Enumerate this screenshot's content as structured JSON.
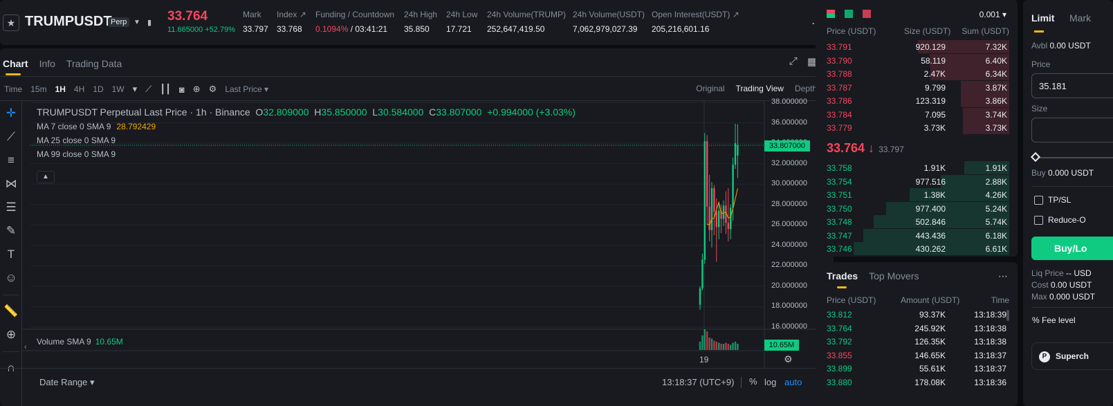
{
  "header": {
    "symbol": "TRUMPUSDT",
    "contract_type": "Perp",
    "last_price": "33.764",
    "change_abs": "11.665000",
    "change_pct": "+52.79%",
    "stats": [
      {
        "label": "Mark",
        "value": "33.797"
      },
      {
        "label": "Index ↗",
        "value": "33.768"
      },
      {
        "label": "Funding / Countdown",
        "value_red": "0.1094%",
        "value": " / 03:41:21"
      },
      {
        "label": "24h High",
        "value": "35.850"
      },
      {
        "label": "24h Low",
        "value": "17.721"
      },
      {
        "label": "24h Volume(TRUMP)",
        "value": "252,647,419.50"
      },
      {
        "label": "24h Volume(USDT)",
        "value": "7,062,979,027.39"
      },
      {
        "label": "Open Interest(USDT) ↗",
        "value": "205,216,601.16"
      }
    ]
  },
  "chart_tabs": [
    "Chart",
    "Info",
    "Trading Data"
  ],
  "toolbar": {
    "intervals": [
      "Time",
      "15m",
      "1H",
      "4H",
      "1D",
      "1W"
    ],
    "price_source": "Last Price ▾",
    "views": [
      "Original",
      "Trading View",
      "Depth"
    ]
  },
  "legend": {
    "title": "TRUMPUSDT Perpetual Last Price · 1h · Binance",
    "o_label": "O",
    "o": "32.809000",
    "h_label": "H",
    "h": "35.850000",
    "l_label": "L",
    "l": "30.584000",
    "c_label": "C",
    "c": "33.807000",
    "chg": "+0.994000 (+3.03%)",
    "ma7": "MA 7 close 0 SMA 9",
    "ma7_val": "28.792429",
    "ma25": "MA 25 close 0 SMA 9",
    "ma99": "MA 99 close 0 SMA 9",
    "volume": "Volume SMA 9",
    "volume_val": "10.65M"
  },
  "chart_data": {
    "type": "candlestick",
    "x_label_shown": "19",
    "yticks": [
      "38.000000",
      "36.000000",
      "34.000000",
      "32.000000",
      "30.000000",
      "28.000000",
      "26.000000",
      "24.000000",
      "22.000000",
      "20.000000",
      "18.000000",
      "16.000000"
    ],
    "ylim": [
      16,
      38
    ],
    "current_price": "33.807000",
    "volume_label": "10.65M",
    "candles": [
      {
        "o": 18.2,
        "h": 20.0,
        "l": 17.7,
        "c": 19.8
      },
      {
        "o": 19.8,
        "h": 23.2,
        "l": 19.6,
        "c": 22.6
      },
      {
        "o": 22.6,
        "h": 35.0,
        "l": 22.2,
        "c": 34.2
      },
      {
        "o": 34.2,
        "h": 34.8,
        "l": 26.0,
        "c": 27.8
      },
      {
        "o": 27.8,
        "h": 30.9,
        "l": 24.4,
        "c": 25.5
      },
      {
        "o": 25.5,
        "h": 30.2,
        "l": 23.8,
        "c": 29.6
      },
      {
        "o": 29.6,
        "h": 29.9,
        "l": 25.0,
        "c": 27.3
      },
      {
        "o": 27.3,
        "h": 28.6,
        "l": 22.4,
        "c": 25.8
      },
      {
        "o": 25.8,
        "h": 28.2,
        "l": 24.6,
        "c": 27.4
      },
      {
        "o": 27.4,
        "h": 28.0,
        "l": 25.2,
        "c": 26.6
      },
      {
        "o": 26.6,
        "h": 28.4,
        "l": 25.9,
        "c": 27.9
      },
      {
        "o": 27.9,
        "h": 29.3,
        "l": 25.1,
        "c": 26.2
      },
      {
        "o": 26.2,
        "h": 29.6,
        "l": 24.4,
        "c": 25.6
      },
      {
        "o": 25.6,
        "h": 28.0,
        "l": 24.6,
        "c": 27.7
      },
      {
        "o": 27.7,
        "h": 32.6,
        "l": 26.4,
        "c": 31.9
      },
      {
        "o": 31.9,
        "h": 35.9,
        "l": 31.5,
        "c": 34.0
      },
      {
        "o": 32.8,
        "h": 35.85,
        "l": 30.6,
        "c": 33.8
      }
    ],
    "volumes": [
      0.4,
      0.7,
      1.0,
      0.9,
      0.6,
      0.55,
      0.45,
      0.4,
      0.35,
      0.3,
      0.3,
      0.35,
      0.3,
      0.25,
      0.35,
      0.4,
      0.3
    ]
  },
  "bottom": {
    "date_range": "Date Range ▾",
    "time": "13:18:37 (UTC+9)",
    "pct": "%",
    "log": "log",
    "auto": "auto"
  },
  "orderbook": {
    "precision": "0.001 ▾",
    "columns": [
      "Price (USDT)",
      "Size (USDT)",
      "Sum (USDT)"
    ],
    "asks": [
      {
        "price": "33.791",
        "size": "920.129",
        "sum": "7.32K",
        "depth": 1.0
      },
      {
        "price": "33.790",
        "size": "58.119",
        "sum": "6.40K",
        "depth": 0.87
      },
      {
        "price": "33.788",
        "size": "2.47K",
        "sum": "6.34K",
        "depth": 0.86
      },
      {
        "price": "33.787",
        "size": "9.799",
        "sum": "3.87K",
        "depth": 0.53
      },
      {
        "price": "33.786",
        "size": "123.319",
        "sum": "3.86K",
        "depth": 0.53
      },
      {
        "price": "33.784",
        "size": "7.095",
        "sum": "3.74K",
        "depth": 0.51
      },
      {
        "price": "33.779",
        "size": "3.73K",
        "sum": "3.73K",
        "depth": 0.51
      }
    ],
    "mid_price": "33.764 ↓",
    "mid_mark": "33.797",
    "bids": [
      {
        "price": "33.758",
        "size": "1.91K",
        "sum": "1.91K",
        "depth": 0.29
      },
      {
        "price": "33.754",
        "size": "977.516",
        "sum": "2.88K",
        "depth": 0.44
      },
      {
        "price": "33.751",
        "size": "1.38K",
        "sum": "4.26K",
        "depth": 0.64
      },
      {
        "price": "33.750",
        "size": "977.400",
        "sum": "5.24K",
        "depth": 0.79
      },
      {
        "price": "33.748",
        "size": "502.846",
        "sum": "5.74K",
        "depth": 0.87
      },
      {
        "price": "33.747",
        "size": "443.436",
        "sum": "6.18K",
        "depth": 0.94
      },
      {
        "price": "33.746",
        "size": "430.262",
        "sum": "6.61K",
        "depth": 1.0
      }
    ]
  },
  "trades": {
    "tabs": [
      "Trades",
      "Top Movers"
    ],
    "columns": [
      "Price (USDT)",
      "Amount (USDT)",
      "Time"
    ],
    "rows": [
      {
        "price": "33.812",
        "amount": "93.37K",
        "time": "13:18:39",
        "side": "buy"
      },
      {
        "price": "33.764",
        "amount": "245.92K",
        "time": "13:18:38",
        "side": "buy"
      },
      {
        "price": "33.792",
        "amount": "126.35K",
        "time": "13:18:38",
        "side": "buy"
      },
      {
        "price": "33.855",
        "amount": "146.65K",
        "time": "13:18:37",
        "side": "sell"
      },
      {
        "price": "33.899",
        "amount": "55.61K",
        "time": "13:18:37",
        "side": "buy"
      },
      {
        "price": "33.880",
        "amount": "178.08K",
        "time": "13:18:36",
        "side": "buy"
      }
    ]
  },
  "order_entry": {
    "tabs": [
      "Limit",
      "Mark"
    ],
    "avbl_label": "Avbl",
    "avbl_value": "0.00 USDT",
    "price_label": "Price",
    "price_value": "35.181",
    "size_label": "Size",
    "buy_label": "Buy",
    "buy_value": "0.000 USDT",
    "tpsl": "TP/SL",
    "reduce_only": "Reduce-O",
    "buy_button": "Buy/Lo",
    "liq_label": "Liq Price",
    "liq_value": "-- USD",
    "cost_label": "Cost",
    "cost_value": "0.00 USDT",
    "max_label": "Max",
    "max_value": "0.000 USDT",
    "fee_level": "Fee level",
    "super": "Superch"
  },
  "colors": {
    "up": "#0ecb81",
    "down": "#f6465d",
    "accent": "#f0b90b",
    "bg": "#0b0e11",
    "panel": "#181a20"
  }
}
